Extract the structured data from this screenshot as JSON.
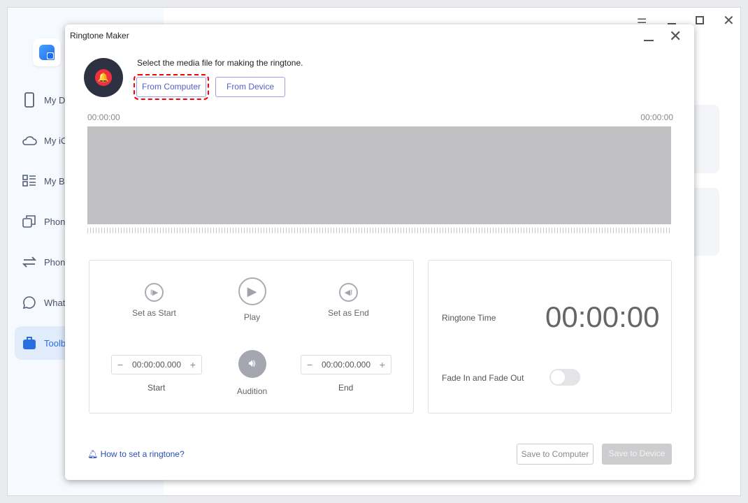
{
  "app": {
    "sidebar": [
      {
        "label": "My Device",
        "icon": "phone-icon"
      },
      {
        "label": "My iCloud",
        "icon": "cloud-icon"
      },
      {
        "label": "My Backups",
        "icon": "list-icon"
      },
      {
        "label": "Phone Manager",
        "icon": "copy-icon"
      },
      {
        "label": "Phone Transfer",
        "icon": "transfer-icon"
      },
      {
        "label": "WhatsApp",
        "icon": "chat-icon"
      },
      {
        "label": "Toolbox",
        "icon": "toolbox-icon",
        "active": true
      }
    ]
  },
  "dialog": {
    "title": "Ringtone Maker",
    "prompt": "Select the media file for making the ringtone.",
    "from_computer": "From Computer",
    "from_device": "From Device",
    "time_start": "00:00:00",
    "time_end": "00:00:00",
    "controls": {
      "set_start": "Set as Start",
      "play": "Play",
      "set_end": "Set as End",
      "start_value": "00:00:00.000",
      "start_label": "Start",
      "audition": "Audition",
      "end_value": "00:00:00.000",
      "end_label": "End"
    },
    "ringtone_time_label": "Ringtone Time",
    "ringtone_time": "00:00:00",
    "fade_label": "Fade In and Fade Out",
    "fade_on": false,
    "help": "How to set a ringtone?",
    "save_computer": "Save to Computer",
    "save_device": "Save to Device"
  },
  "colors": {
    "accent": "#5560c8",
    "highlight": "#ff0000",
    "alarm": "#f0303f"
  }
}
